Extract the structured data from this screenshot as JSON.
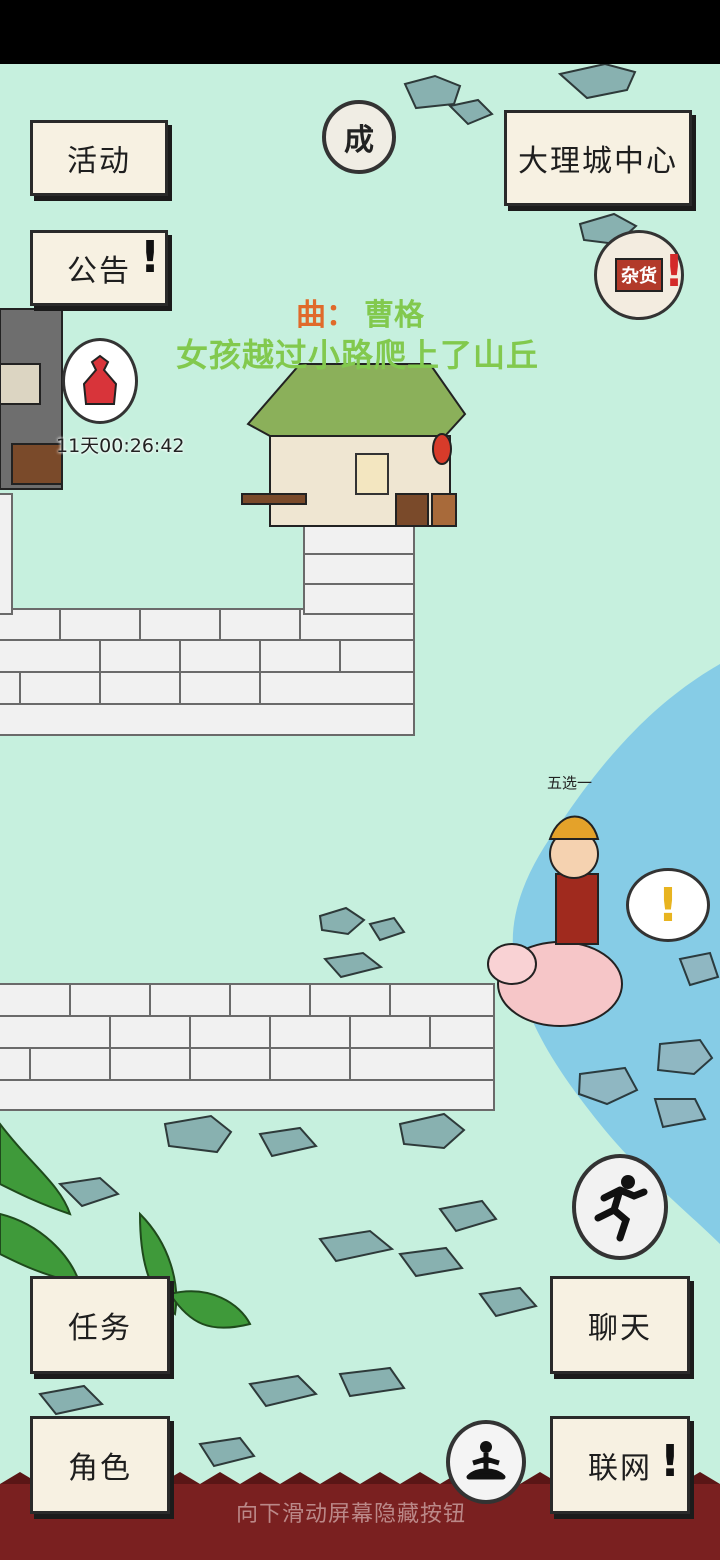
{
  "top_left_buttons": {
    "activity": "活动",
    "notice": "公告"
  },
  "location": {
    "name": "大理城中心"
  },
  "music": {
    "prefix": "曲：",
    "song": "曹格",
    "lyric": "女孩越过小路爬上了山丘"
  },
  "gift": {
    "countdown": "11天00:26:42"
  },
  "npc": {
    "name": "五选一"
  },
  "bottom_buttons": {
    "task": "任务",
    "role": "角色",
    "chat": "聊天",
    "network": "联网"
  },
  "hint": "向下滑动屏幕隐藏按钮",
  "icons": {
    "achievement": "成",
    "shop": "杂货",
    "run": "run-icon",
    "meditate": "meditate-icon"
  },
  "alert_mark": "!"
}
